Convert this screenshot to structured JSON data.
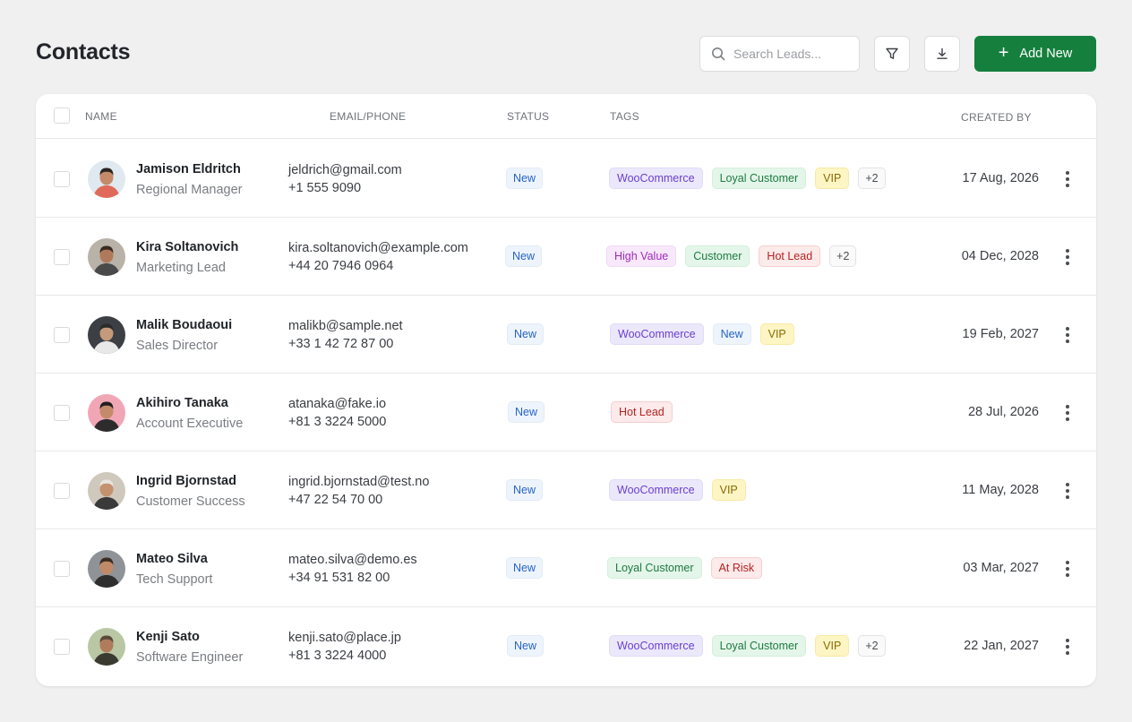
{
  "page": {
    "title": "Contacts"
  },
  "toolbar": {
    "search_placeholder": "Search Leads...",
    "add_label": "Add New",
    "add_icon": "plus-icon",
    "filter_icon": "filter-icon",
    "download_icon": "download-icon"
  },
  "colors": {
    "accent": "#15803d",
    "status_new_bg": "#eef4fc",
    "status_new_text": "#2563c7"
  },
  "table": {
    "headers": {
      "name": "NAME",
      "email_phone": "EMAIL/PHONE",
      "status": "STATUS",
      "tags": "TAGS",
      "created_by": "CREATED BY"
    },
    "rows": [
      {
        "name": "Jamison Eldritch",
        "role": "Regional Manager",
        "email": "jeldrich@gmail.com",
        "phone": "+1 555 9090",
        "status": "New",
        "tags": [
          "WooCommerce",
          "Loyal Customer",
          "VIP",
          "+2"
        ],
        "date": "17 Aug, 2026"
      },
      {
        "name": "Kira Soltanovich",
        "role": "Marketing Lead",
        "email": "kira.soltanovich@example.com",
        "phone": "+44 20 7946 0964",
        "status": "New",
        "tags": [
          "High Value",
          "Customer",
          "Hot Lead",
          "+2"
        ],
        "date": "04 Dec, 2028"
      },
      {
        "name": "Malik Boudaoui",
        "role": "Sales Director",
        "email": "malikb@sample.net",
        "phone": "+33 1 42 72 87 00",
        "status": "New",
        "tags": [
          "WooCommerce",
          "New",
          "VIP"
        ],
        "date": "19 Feb, 2027"
      },
      {
        "name": "Akihiro Tanaka",
        "role": "Account Executive",
        "email": "atanaka@fake.io",
        "phone": "+81 3 3224 5000",
        "status": "New",
        "tags": [
          "Hot Lead"
        ],
        "date": "28 Jul, 2026"
      },
      {
        "name": "Ingrid Bjornstad",
        "role": "Customer Success",
        "email": "ingrid.bjornstad@test.no",
        "phone": "+47 22 54 70 00",
        "status": "New",
        "tags": [
          "WooCommerce",
          "VIP"
        ],
        "date": "11 May, 2028"
      },
      {
        "name": "Mateo Silva",
        "role": "Tech Support",
        "email": "mateo.silva@demo.es",
        "phone": "+34 91 531 82 00",
        "status": "New",
        "tags": [
          "Loyal Customer",
          "At Risk"
        ],
        "date": "03 Mar, 2027"
      },
      {
        "name": "Kenji Sato",
        "role": "Software Engineer",
        "email": "kenji.sato@place.jp",
        "phone": "+81 3 3224 4000",
        "status": "New",
        "tags": [
          "WooCommerce",
          "Loyal Customer",
          "VIP",
          "+2"
        ],
        "date": "22 Jan, 2027"
      }
    ]
  }
}
